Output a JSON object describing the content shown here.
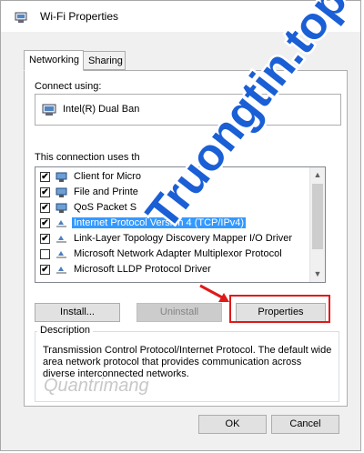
{
  "window": {
    "title": "Wi-Fi Properties"
  },
  "tabs": [
    {
      "label": "Networking"
    },
    {
      "label": "Sharing"
    }
  ],
  "connect_using": {
    "label": "Connect using:",
    "adapter": "Intel(R) Dual Ban"
  },
  "items_label": "This connection uses th",
  "items": [
    {
      "label": "Client for Micro",
      "checked": true,
      "icon": "network-client-icon"
    },
    {
      "label": "File and Printe",
      "checked": true,
      "icon": "file-printer-sharing-icon"
    },
    {
      "label": "QoS Packet S",
      "checked": true,
      "icon": "qos-scheduler-icon"
    },
    {
      "label": "Internet Protocol Version 4 (TCP/IPv4)",
      "checked": true,
      "icon": "protocol-icon",
      "selected": true
    },
    {
      "label": "Link-Layer Topology Discovery Mapper I/O Driver",
      "checked": true,
      "icon": "protocol-icon"
    },
    {
      "label": "Microsoft Network Adapter Multiplexor Protocol",
      "checked": false,
      "icon": "protocol-icon"
    },
    {
      "label": "Microsoft LLDP Protocol Driver",
      "checked": true,
      "icon": "protocol-icon"
    }
  ],
  "buttons": {
    "install": "Install...",
    "uninstall": "Uninstall",
    "properties": "Properties",
    "ok": "OK",
    "cancel": "Cancel"
  },
  "description": {
    "legend": "Description",
    "text": "Transmission Control Protocol/Internet Protocol. The default wide area network protocol that provides communication across diverse interconnected networks."
  },
  "watermark": {
    "brand": "Truongtin.top",
    "bottom": "Quantrimang"
  },
  "colors": {
    "selection": "#3399ff",
    "highlight": "#e01919",
    "brand": "#1a5fd6"
  }
}
